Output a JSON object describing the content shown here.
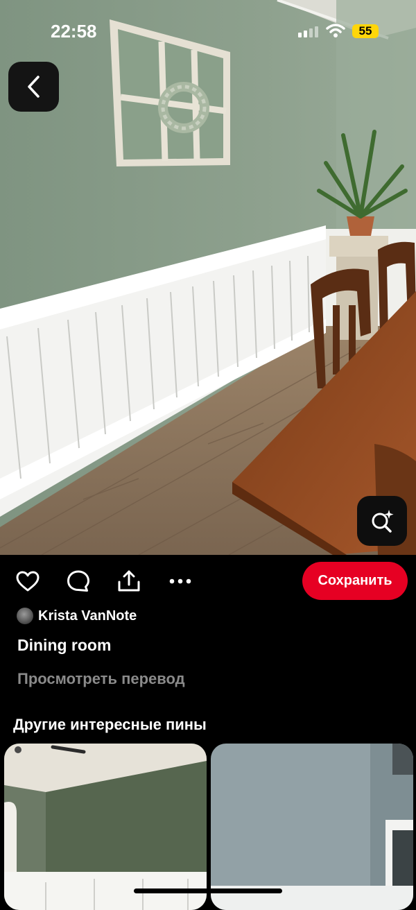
{
  "status_bar": {
    "time": "22:58",
    "battery": "55",
    "icons": [
      "signal-icon",
      "wifi-icon",
      "battery-icon"
    ]
  },
  "nav": {
    "back_icon": "chevron-left-icon",
    "visual_search_icon": "lens-search-icon"
  },
  "actions": {
    "icons": [
      "heart-icon",
      "comment-icon",
      "share-icon",
      "more-icon"
    ],
    "save_label": "Сохранить",
    "save_color": "#e60023"
  },
  "pin": {
    "author": "Krista VanNote",
    "title": "Dining room",
    "translate_label": "Просмотреть перевод"
  },
  "more_pins": {
    "title": "Другие интересные пины"
  }
}
